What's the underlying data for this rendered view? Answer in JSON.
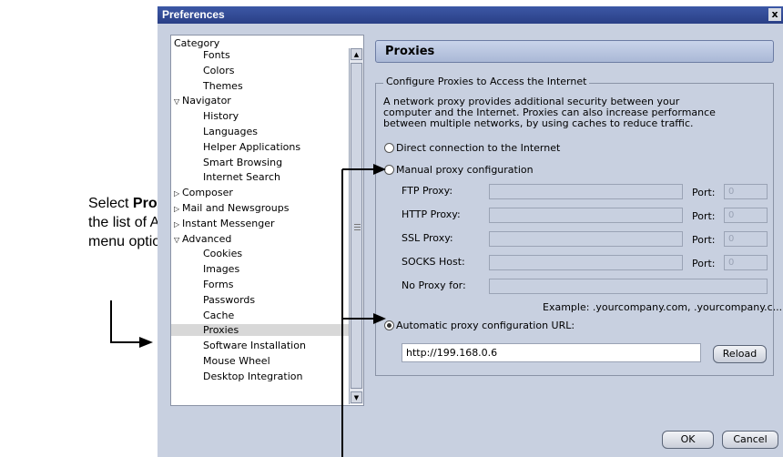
{
  "callout": {
    "prefix": "Select ",
    "bold": "Proxies",
    "rest": " from the list of Advanced menu options."
  },
  "window": {
    "title": "Preferences",
    "close_glyph": "x"
  },
  "category": {
    "header": "Category",
    "items": [
      {
        "label": "Fonts",
        "indent": 2,
        "twisty": ""
      },
      {
        "label": "Colors",
        "indent": 2,
        "twisty": ""
      },
      {
        "label": "Themes",
        "indent": 2,
        "twisty": ""
      },
      {
        "label": "Navigator",
        "indent": 0,
        "twisty": "▽"
      },
      {
        "label": "History",
        "indent": 2,
        "twisty": ""
      },
      {
        "label": "Languages",
        "indent": 2,
        "twisty": ""
      },
      {
        "label": "Helper Applications",
        "indent": 2,
        "twisty": ""
      },
      {
        "label": "Smart Browsing",
        "indent": 2,
        "twisty": ""
      },
      {
        "label": "Internet Search",
        "indent": 2,
        "twisty": ""
      },
      {
        "label": "Composer",
        "indent": 0,
        "twisty": "▷"
      },
      {
        "label": "Mail and Newsgroups",
        "indent": 0,
        "twisty": "▷"
      },
      {
        "label": "Instant Messenger",
        "indent": 0,
        "twisty": "▷"
      },
      {
        "label": "Advanced",
        "indent": 0,
        "twisty": "▽"
      },
      {
        "label": "Cookies",
        "indent": 2,
        "twisty": ""
      },
      {
        "label": "Images",
        "indent": 2,
        "twisty": ""
      },
      {
        "label": "Forms",
        "indent": 2,
        "twisty": ""
      },
      {
        "label": "Passwords",
        "indent": 2,
        "twisty": ""
      },
      {
        "label": "Cache",
        "indent": 2,
        "twisty": ""
      },
      {
        "label": "Proxies",
        "indent": 2,
        "twisty": "",
        "selected": true
      },
      {
        "label": "Software Installation",
        "indent": 2,
        "twisty": ""
      },
      {
        "label": "Mouse Wheel",
        "indent": 2,
        "twisty": ""
      },
      {
        "label": "Desktop Integration",
        "indent": 2,
        "twisty": ""
      }
    ]
  },
  "panel": {
    "title": "Proxies",
    "group_legend": "Configure Proxies to Access the Internet",
    "description": [
      "A network proxy provides additional security between your",
      "computer and the Internet. Proxies can also increase performance",
      "between multiple networks, by using caches to reduce traffic."
    ],
    "radio_direct": "Direct connection to the Internet",
    "radio_manual": "Manual proxy configuration",
    "ftp_label": "FTP Proxy:",
    "http_label": "HTTP Proxy:",
    "ssl_label": "SSL Proxy:",
    "socks_label": "SOCKS Host:",
    "noproxy_label": "No Proxy for:",
    "port_label": "Port:",
    "port_value": "0",
    "example": "Example: .yourcompany.com, .yourcompany.c...",
    "radio_auto": "Automatic proxy configuration URL:",
    "auto_url": "http://199.168.0.6",
    "reload": "Reload"
  },
  "buttons": {
    "ok": "OK",
    "cancel": "Cancel"
  }
}
